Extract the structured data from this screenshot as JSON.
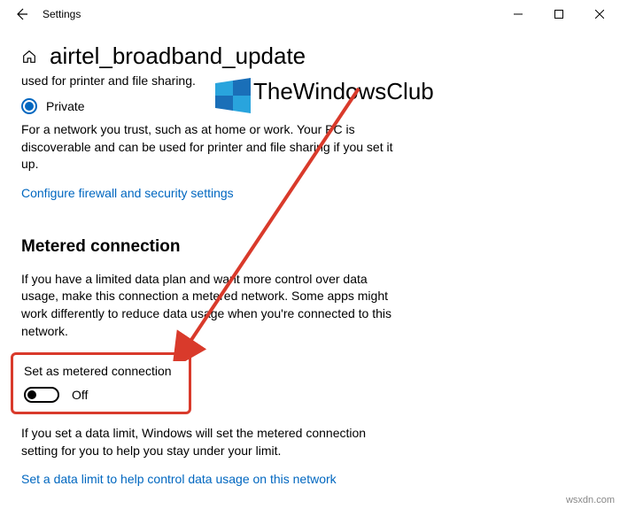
{
  "titlebar": {
    "title": "Settings"
  },
  "page": {
    "title": "airtel_broadband_update"
  },
  "profile": {
    "cut_text": "used for printer and file sharing.",
    "private_label": "Private",
    "private_desc": "For a network you trust, such as at home or work. Your PC is discoverable and can be used for printer and file sharing if you set it up.",
    "firewall_link": "Configure firewall and security settings"
  },
  "metered": {
    "heading": "Metered connection",
    "desc": "If you have a limited data plan and want more control over data usage, make this connection a metered network. Some apps might work differently to reduce data usage when you're connected to this network.",
    "toggle_label": "Set as metered connection",
    "toggle_state": "Off",
    "limit_desc": "If you set a data limit, Windows will set the metered connection setting for you to help you stay under your limit.",
    "limit_link": "Set a data limit to help control data usage on this network"
  },
  "watermark": {
    "text": "TheWindowsClub"
  },
  "credit": "wsxdn.com",
  "colors": {
    "accent": "#0067c0",
    "highlight": "#d93a2b"
  }
}
